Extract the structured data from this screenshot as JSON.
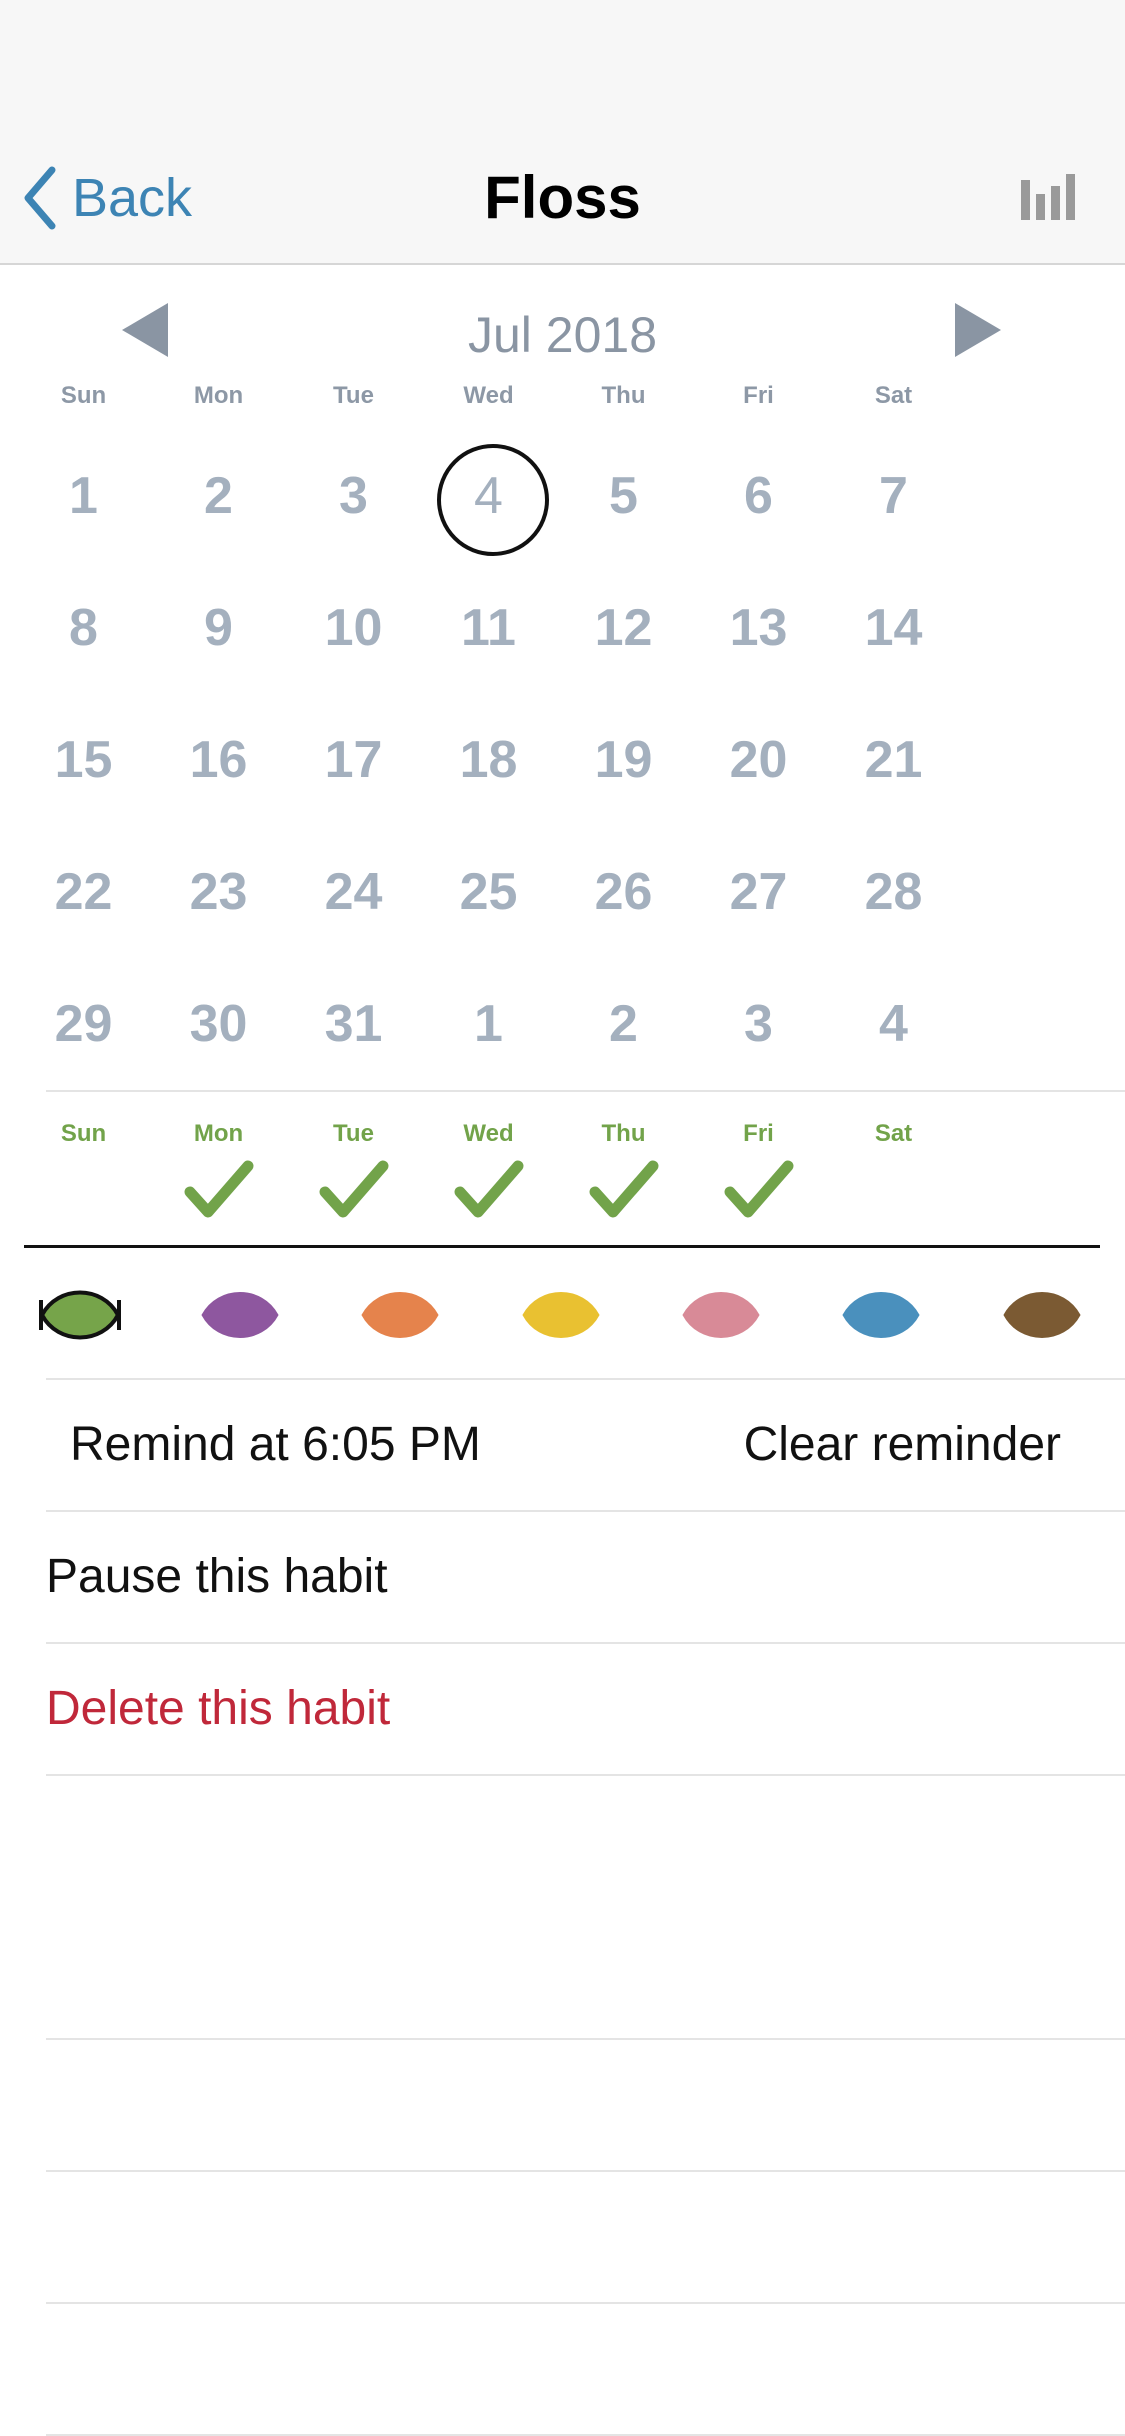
{
  "nav": {
    "back_label": "Back",
    "title": "Floss"
  },
  "calendar": {
    "month": "Jul 2018",
    "weekday_labels": [
      "Sun",
      "Mon",
      "Tue",
      "Wed",
      "Thu",
      "Fri",
      "Sat"
    ],
    "weeks": [
      [
        "1",
        "2",
        "3",
        "4",
        "5",
        "6",
        "7"
      ],
      [
        "8",
        "9",
        "10",
        "11",
        "12",
        "13",
        "14"
      ],
      [
        "15",
        "16",
        "17",
        "18",
        "19",
        "20",
        "21"
      ],
      [
        "22",
        "23",
        "24",
        "25",
        "26",
        "27",
        "28"
      ],
      [
        "29",
        "30",
        "31",
        "1",
        "2",
        "3",
        "4"
      ]
    ],
    "today": "4"
  },
  "schedule": {
    "labels": [
      "Sun",
      "Mon",
      "Tue",
      "Wed",
      "Thu",
      "Fri",
      "Sat"
    ],
    "checked": [
      false,
      true,
      true,
      true,
      true,
      true,
      false
    ]
  },
  "colors": {
    "swatches": [
      "#76a44a",
      "#8e579f",
      "#e5834c",
      "#e9c131",
      "#d88a97",
      "#4a90bd",
      "#7b5a33"
    ],
    "selected_index": 0,
    "accent": "#3d84b4",
    "check": "#72a34a",
    "danger": "#c0283a"
  },
  "reminder": {
    "label": "Remind at 6:05 PM",
    "clear_label": "Clear reminder"
  },
  "actions": {
    "pause_label": "Pause this habit",
    "delete_label": "Delete this habit"
  }
}
